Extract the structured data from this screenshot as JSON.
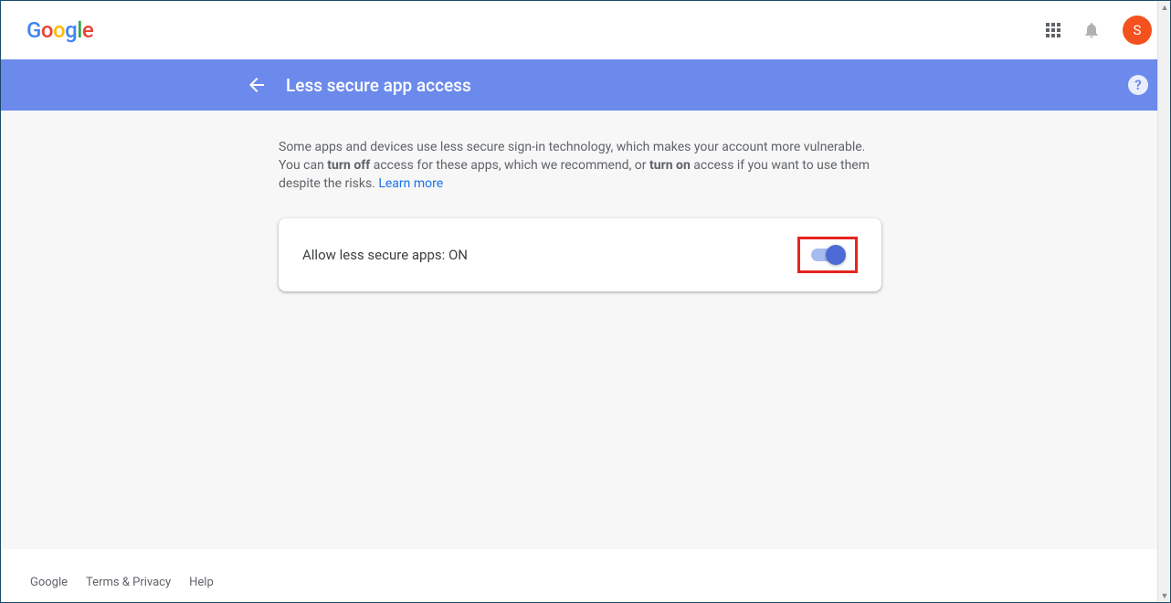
{
  "header": {
    "avatar_letter": "S"
  },
  "bluebar": {
    "title": "Less secure app access"
  },
  "description": {
    "part1": "Some apps and devices use less secure sign-in technology, which makes your account more vulnerable. You can ",
    "bold1": "turn off",
    "part2": " access for these apps, which we recommend, or ",
    "bold2": "turn on",
    "part3": " access if you want to use them despite the risks. ",
    "learn_more": "Learn more"
  },
  "card": {
    "label": "Allow less secure apps: ON"
  },
  "footer": {
    "google": "Google",
    "terms": "Terms & Privacy",
    "help": "Help"
  }
}
